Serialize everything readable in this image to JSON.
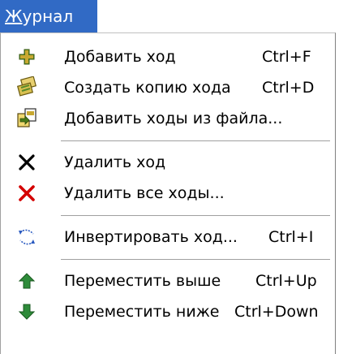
{
  "menu": {
    "title": "Журнал",
    "title_accel": "Ж",
    "title_rest": "урнал"
  },
  "items": [
    {
      "label": "Добавить ход",
      "shortcut": "Ctrl+F",
      "icon": "plus-icon"
    },
    {
      "label": "Создать копию хода",
      "shortcut": "Ctrl+D",
      "icon": "copy-pages-icon"
    },
    {
      "label": "Добавить ходы из файла...",
      "shortcut": "",
      "icon": "import-file-icon"
    },
    {
      "label": "Удалить ход",
      "shortcut": "",
      "icon": "delete-black-x-icon"
    },
    {
      "label": "Удалить все ходы...",
      "shortcut": "",
      "icon": "delete-red-x-icon"
    },
    {
      "label": "Инвертировать ход...",
      "shortcut": "Ctrl+I",
      "icon": "invert-arrows-icon"
    },
    {
      "label": "Переместить выше",
      "shortcut": "Ctrl+Up",
      "icon": "arrow-up-icon"
    },
    {
      "label": "Переместить ниже",
      "shortcut": "Ctrl+Down",
      "icon": "arrow-down-icon"
    }
  ],
  "colors": {
    "highlight": "#316ac5",
    "green": "#2e8b3a",
    "red": "#d40000"
  }
}
